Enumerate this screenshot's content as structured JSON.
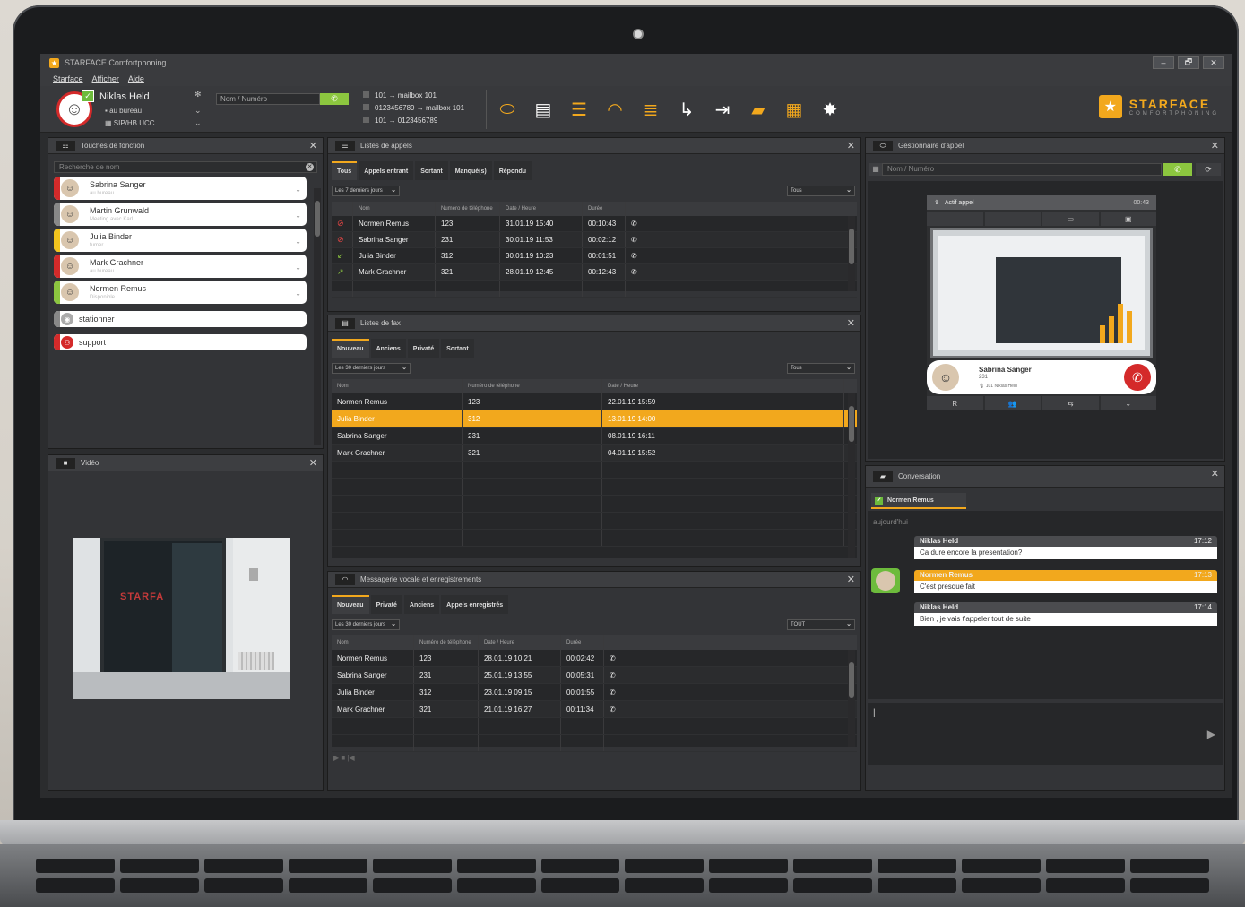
{
  "window": {
    "title": "STARFACE Comfortphoning",
    "buttons": [
      "–",
      "🗗",
      "✕"
    ]
  },
  "menu": [
    "Starface",
    "Afficher",
    "Aide"
  ],
  "user": {
    "name": "Niklas Held",
    "status": "au bureau",
    "line": "SIP/HB UCC"
  },
  "dial": {
    "placeholder": "Nom / Numéro"
  },
  "redirects": [
    "101 → mailbox 101",
    "0123456789 → mailbox 101",
    "101 → 0123456789"
  ],
  "brand": {
    "name": "STARFACE",
    "sub": "COMFORTPHONING"
  },
  "functionkeys": {
    "title": "Touches de fonction",
    "search": "Recherche de nom",
    "contacts": [
      {
        "name": "Sabrina Sanger",
        "status": "au bureau",
        "color": "#d42a2a"
      },
      {
        "name": "Martin Grunwald",
        "status": "Meeting avec Karl",
        "color": "#888888"
      },
      {
        "name": "Julia Binder",
        "status": "fumer",
        "color": "#f2c41d"
      },
      {
        "name": "Mark Grachner",
        "status": "au bureau",
        "color": "#d42a2a"
      },
      {
        "name": "Normen Remus",
        "status": "Disponible",
        "color": "#8cc63f"
      }
    ],
    "groups": [
      {
        "name": "stationner"
      },
      {
        "name": "support"
      }
    ]
  },
  "video": {
    "title": "Vidéo"
  },
  "calllists": {
    "title": "Listes de appels",
    "tabs": [
      "Tous",
      "Appels entrant",
      "Sortant",
      "Manqué(s)",
      "Répondu"
    ],
    "range": "Les 7 derniers jours",
    "filter": "Tous",
    "headers": [
      "Nom",
      "Numéro de téléphone",
      "Date / Heure",
      "Durée"
    ],
    "rows": [
      {
        "icon": "⊘",
        "name": "Normen Remus",
        "number": "123",
        "date": "31.01.19 15:40",
        "dur": "00:10:43"
      },
      {
        "icon": "⊘",
        "name": "Sabrina Sanger",
        "number": "231",
        "date": "30.01.19 11:53",
        "dur": "00:02:12"
      },
      {
        "icon": "↙",
        "name": "Julia Binder",
        "number": "312",
        "date": "30.01.19 10:23",
        "dur": "00:01:51"
      },
      {
        "icon": "↗",
        "name": "Mark Grachner",
        "number": "321",
        "date": "28.01.19 12:45",
        "dur": "00:12:43"
      }
    ]
  },
  "faxlists": {
    "title": "Listes de fax",
    "tabs": [
      "Nouveau",
      "Anciens",
      "Privaté",
      "Sortant"
    ],
    "range": "Les 30 derniers jours",
    "filter": "Tous",
    "headers": [
      "Nom",
      "Numéro de téléphone",
      "Date / Heure"
    ],
    "rows": [
      {
        "name": "Normen Remus",
        "number": "123",
        "date": "22.01.19 15:59"
      },
      {
        "name": "Julia Binder",
        "number": "312",
        "date": "13.01.19 14:00"
      },
      {
        "name": "Sabrina Sanger",
        "number": "231",
        "date": "08.01.19 16:11"
      },
      {
        "name": "Mark Grachner",
        "number": "321",
        "date": "04.01.19 15:52"
      }
    ]
  },
  "voicemail": {
    "title": "Messagerie vocale et enregistrements",
    "tabs": [
      "Nouveau",
      "Privaté",
      "Anciens",
      "Appels enregistrés"
    ],
    "range": "Les 30 derniers jours",
    "filter": "TOUT",
    "headers": [
      "Nom",
      "Numéro de téléphone",
      "Date / Heure",
      "Durée"
    ],
    "rows": [
      {
        "name": "Normen Remus",
        "number": "123",
        "date": "28.01.19 10:21",
        "dur": "00:02:42"
      },
      {
        "name": "Sabrina Sanger",
        "number": "231",
        "date": "25.01.19 13:55",
        "dur": "00:05:31"
      },
      {
        "name": "Julia Binder",
        "number": "312",
        "date": "23.01.19 09:15",
        "dur": "00:01:55"
      },
      {
        "name": "Mark Grachner",
        "number": "321",
        "date": "21.01.19 16:27",
        "dur": "00:11:34"
      }
    ]
  },
  "callmanager": {
    "title": "Gestionnaire d'appel",
    "placeholder": "Nom / Numéro",
    "active": {
      "label": "Actif appel",
      "time": "00:43",
      "name": "Sabrina Sanger",
      "number": "231",
      "via": "101 Niklas Held"
    },
    "controls": [
      "R",
      "👥",
      "⇆",
      "⌄"
    ]
  },
  "conversation": {
    "title": "Conversation",
    "tab": "Normen Remus",
    "day": "aujourd'hui",
    "messages": [
      {
        "from": "Niklas Held",
        "time": "17:12",
        "text": "Ca dure encore la presentation?"
      },
      {
        "from": "Normen Remus",
        "time": "17:13",
        "text": "C'est presque fait"
      },
      {
        "from": "Niklas Held",
        "time": "17:14",
        "text": "Bien , je vais t'appeler tout de suite"
      }
    ]
  }
}
